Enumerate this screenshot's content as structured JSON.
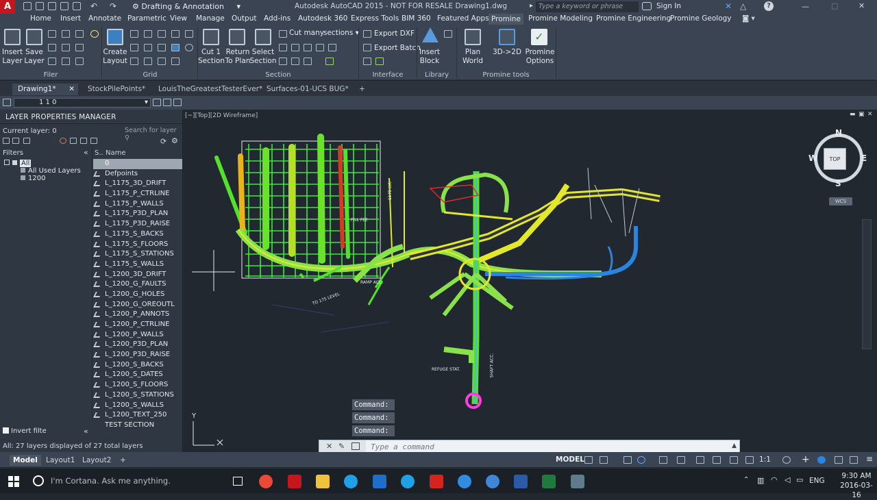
{
  "app": {
    "logo": "A",
    "workspace": "Drafting & Annotation",
    "title": "Autodesk AutoCAD 2015 - NOT FOR RESALE   Drawing1.dwg",
    "search_placeholder": "Type a keyword or phrase",
    "sign_in": "Sign In"
  },
  "menu": [
    "Home",
    "Insert",
    "Annotate",
    "Parametric",
    "View",
    "Manage",
    "Output",
    "Add-ins",
    "Autodesk 360",
    "Express Tools",
    "BIM 360",
    "Featured Apps",
    "Promine",
    "Promine Modeling",
    "Promine Engineering",
    "Promine Geology"
  ],
  "menu_active": "Promine",
  "ribbon": {
    "insert_layer": [
      "Insert",
      "Layer"
    ],
    "save_layer": [
      "Save",
      "Layer"
    ],
    "create_layout": [
      "Create",
      "Layout"
    ],
    "cut_section": [
      "Cut 1",
      "Section"
    ],
    "return_to_plan": [
      "Return",
      "To Plan"
    ],
    "select_section": [
      "Select",
      "Section"
    ],
    "cut_many": "Cut many",
    "sections": "sections",
    "export_dxf": "Export DXF",
    "export_batch": "Export Batch",
    "insert_block": [
      "Insert",
      "Block"
    ],
    "plan_world": [
      "Plan",
      "World"
    ],
    "convert_3d_2d": "3D->2D",
    "promine_options": [
      "Promine",
      "Options"
    ],
    "panels": {
      "filer": "Filer",
      "grid": "Grid",
      "section": "Section",
      "interface": "Interface",
      "library": "Library",
      "promine_tools": "Promine tools"
    }
  },
  "doc_tabs": [
    "Drawing1*",
    "StockPilePoints*",
    "LouisTheGreatestTesterEver*",
    "Surfaces-01-UCS BUG*"
  ],
  "layer_combo": "1 1 0",
  "layer_manager": {
    "title": "LAYER PROPERTIES MANAGER",
    "current_layer": "Current layer: 0",
    "search_placeholder": "Search for layer",
    "filters_label": "Filters",
    "filter_all": "All",
    "filter_used": "All Used Layers",
    "filter_1200": "1200",
    "col_status": "S..",
    "col_name": "Name",
    "layers": [
      "0",
      "Defpoints",
      "L_1175_3D_DRIFT",
      "L_1175_P_CTRLINE",
      "L_1175_P_WALLS",
      "L_1175_P3D_PLAN",
      "L_1175_P3D_RAISE",
      "L_1175_S_BACKS",
      "L_1175_S_FLOORS",
      "L_1175_S_STATIONS",
      "L_1175_S_WALLS",
      "L_1200_3D_DRIFT",
      "L_1200_G_FAULTS",
      "L_1200_G_HOLES",
      "L_1200_G_OREOUTL",
      "L_1200_P_ANNOTS",
      "L_1200_P_CTRLINE",
      "L_1200_P_WALLS",
      "L_1200_P3D_PLAN",
      "L_1200_P3D_RAISE",
      "L_1200_S_BACKS",
      "L_1200_S_DATES",
      "L_1200_S_FLOORS",
      "L_1200_S_STATIONS",
      "L_1200_S_WALLS",
      "L_1200_TEXT_250",
      "TEST SECTION"
    ],
    "invert_filter": "Invert filte",
    "status": "All: 27 layers displayed of 27 total layers"
  },
  "viewport": {
    "label": "[−][Top][2D Wireframe]",
    "compass": {
      "n": "N",
      "s": "S",
      "e": "E",
      "w": "W",
      "top": "TOP"
    },
    "wcs": "WCS",
    "ucs_y": "Y",
    "labels": {
      "ramp": "RAMP ACC.",
      "to175": "TO 175 LEVEL",
      "refuge": "REFUGE STAT.",
      "shaft": "SHAFT ACC.",
      "fillfee": "FILL FEE",
      "level1175": "1175 LVL"
    }
  },
  "command": {
    "history": [
      "Command:",
      "Command:",
      "Command:"
    ],
    "placeholder": "Type a command"
  },
  "bottom_tabs": [
    "Model",
    "Layout1",
    "Layout2"
  ],
  "status_bar": {
    "model": "MODEL",
    "scale": "1:1"
  },
  "taskbar": {
    "cortana": "I'm Cortana. Ask me anything.",
    "lang": "ENG",
    "time": "9:30 AM",
    "date": "2016-03-16"
  }
}
